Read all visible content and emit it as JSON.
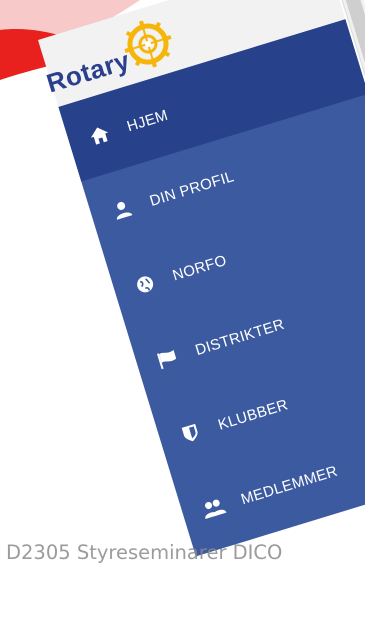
{
  "brand": {
    "logo_text": "Rotary",
    "colors": {
      "brand_blue": "#2a3f8e",
      "nav_bg": "#3c5aa0",
      "nav_active": "#27428a",
      "gold": "#f5b50a",
      "red": "#e8201e"
    }
  },
  "nav": {
    "items": [
      {
        "label": "HJEM",
        "icon": "home-icon",
        "active": true
      },
      {
        "label": "DIN PROFIL",
        "icon": "user-icon",
        "active": false
      },
      {
        "label": "NORFO",
        "icon": "globe-icon",
        "active": false
      },
      {
        "label": "DISTRIKTER",
        "icon": "flag-icon",
        "active": false
      },
      {
        "label": "KLUBBER",
        "icon": "shield-icon",
        "active": false
      },
      {
        "label": "MEDLEMMER",
        "icon": "users-icon",
        "active": false
      }
    ]
  },
  "footer": {
    "text": "D2305 Styreseminarer DICO"
  }
}
